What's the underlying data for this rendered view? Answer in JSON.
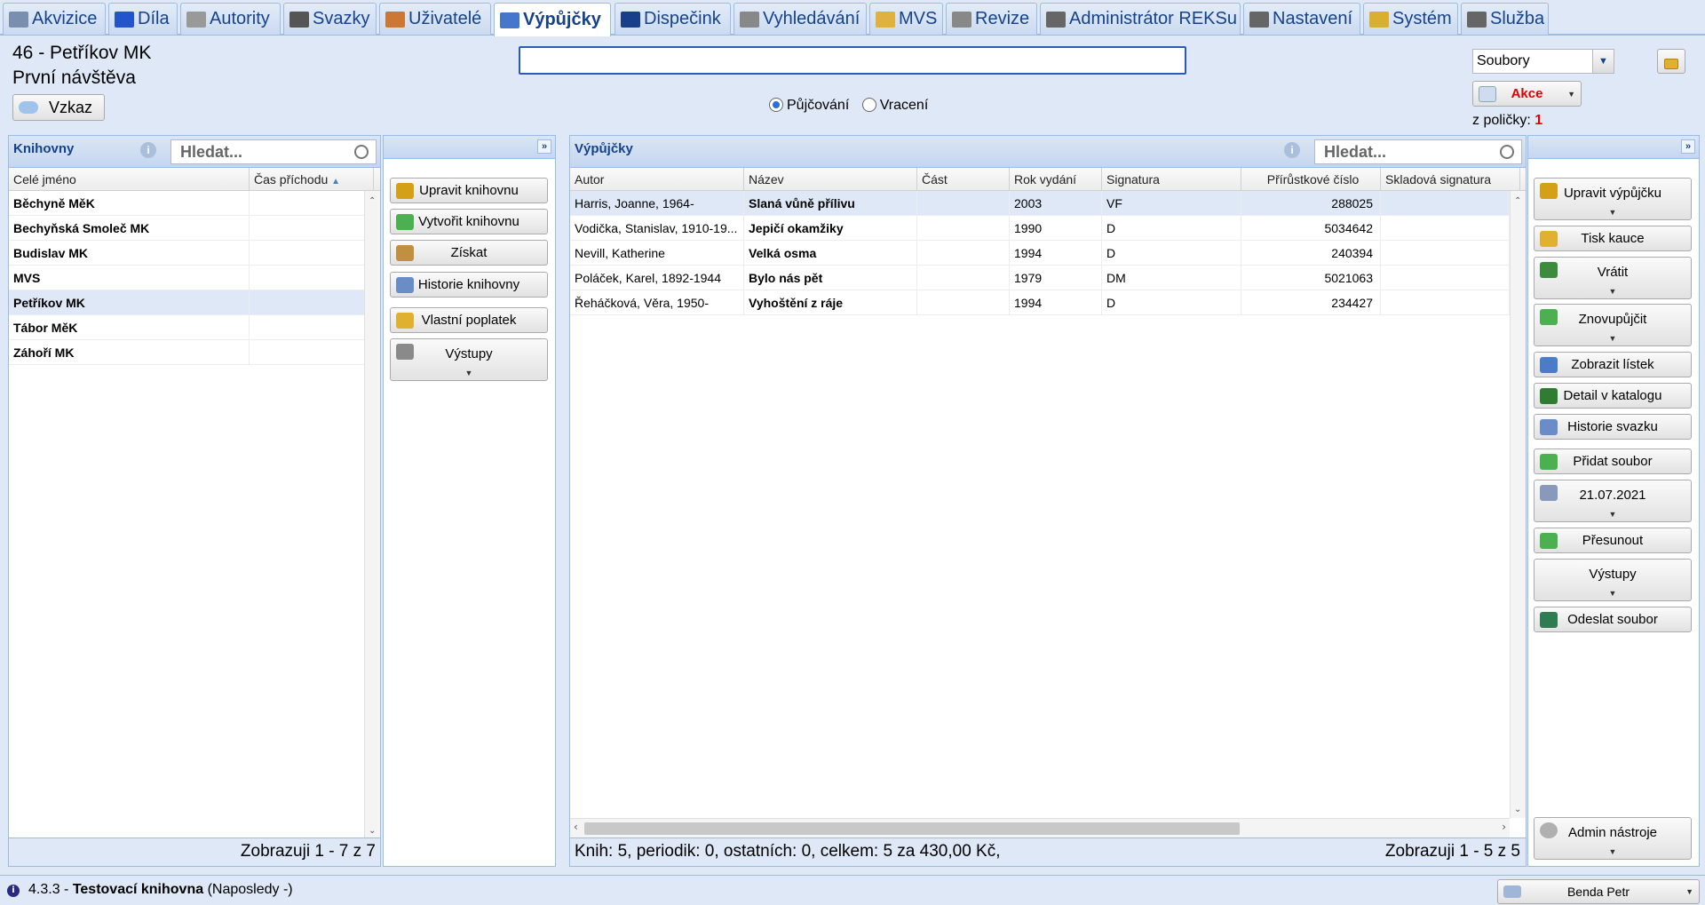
{
  "tabs": [
    {
      "label": "Akvizice",
      "icon": "cart-icon",
      "color": "#7a8fb0"
    },
    {
      "label": "Díla",
      "icon": "book-icon",
      "color": "#2255cc"
    },
    {
      "label": "Autority",
      "icon": "card-icon",
      "color": "#999999"
    },
    {
      "label": "Svazky",
      "icon": "pen-icon",
      "color": "#555555"
    },
    {
      "label": "Uživatelé",
      "icon": "users-icon",
      "color": "#cc7733"
    },
    {
      "label": "Výpůjčky",
      "icon": "books-icon",
      "color": "#4477cc"
    },
    {
      "label": "Dispečink",
      "icon": "monitor-icon",
      "color": "#1a3f8a"
    },
    {
      "label": "Vyhledávání",
      "icon": "cabinet-icon",
      "color": "#888888"
    },
    {
      "label": "MVS",
      "icon": "box-icon",
      "color": "#e0b040"
    },
    {
      "label": "Revize",
      "icon": "list-icon",
      "color": "#888888"
    },
    {
      "label": "Administrátor REKSu",
      "icon": "tools-icon",
      "color": "#666666"
    },
    {
      "label": "Nastavení",
      "icon": "tools-icon",
      "color": "#666666"
    },
    {
      "label": "Systém",
      "icon": "key-icon",
      "color": "#d8b030"
    },
    {
      "label": "Služba",
      "icon": "tools-icon",
      "color": "#666666"
    }
  ],
  "header": {
    "library_name": "46 - Petříkov MK",
    "visit": "První návštěva",
    "message_button": "Vzkaz",
    "barcode_value": "",
    "radio_lend": "Půjčování",
    "radio_return": "Vracení",
    "files_select": "Soubory",
    "actions_button": "Akce",
    "shelf_label": "z poličky:",
    "shelf_count": "1"
  },
  "libraries": {
    "title": "Knihovny",
    "search_placeholder": "Hledat...",
    "columns": [
      "Celé jméno",
      "Čas příchodu"
    ],
    "rows": [
      {
        "name": "Běchyně MěK",
        "time": ""
      },
      {
        "name": "Bechyňská Smoleč MK",
        "time": ""
      },
      {
        "name": "Budislav MK",
        "time": ""
      },
      {
        "name": "MVS",
        "time": ""
      },
      {
        "name": "Petříkov MK",
        "time": ""
      },
      {
        "name": "Tábor MěK",
        "time": ""
      },
      {
        "name": "Záhoří MK",
        "time": ""
      }
    ],
    "footer": "Zobrazuji 1 - 7 z 7"
  },
  "library_actions": [
    {
      "label": "Upravit knihovnu",
      "icon": "pencil-icon",
      "color": "#d4a017"
    },
    {
      "label": "Vytvořit knihovnu",
      "icon": "add-icon",
      "color": "#4caf50"
    },
    {
      "label": "Získat",
      "icon": "coins-icon",
      "color": "#c09040"
    },
    {
      "label": "Historie knihovny",
      "icon": "info-icon",
      "color": "#6a8cc7"
    },
    {
      "label": "Vlastní poplatek",
      "icon": "money-icon",
      "color": "#e0b030"
    },
    {
      "label": "Výstupy",
      "icon": "printer-icon",
      "color": "#8a8a8a"
    }
  ],
  "loans": {
    "title": "Výpůjčky",
    "search_placeholder": "Hledat...",
    "columns": [
      "Autor",
      "Název",
      "Část",
      "Rok vydání",
      "Signatura",
      "Přírůstkové číslo",
      "Skladová signatura"
    ],
    "rows": [
      {
        "author": "Harris, Joanne, 1964-",
        "title": "Slaná vůně přílivu",
        "part": "",
        "year": "2003",
        "sig": "VF",
        "acc": "288025",
        "store": ""
      },
      {
        "author": "Vodička, Stanislav, 1910-19...",
        "title": "Jepičí okamžiky",
        "part": "",
        "year": "1990",
        "sig": "D",
        "acc": "5034642",
        "store": ""
      },
      {
        "author": "Nevill, Katherine",
        "title": "Velká osma",
        "part": "",
        "year": "1994",
        "sig": "D",
        "acc": "240394",
        "store": ""
      },
      {
        "author": "Poláček, Karel, 1892-1944",
        "title": "Bylo nás pět",
        "part": "",
        "year": "1979",
        "sig": "DM",
        "acc": "5021063",
        "store": ""
      },
      {
        "author": "Řeháčková, Věra, 1950-",
        "title": "Vyhoštění z ráje",
        "part": "",
        "year": "1994",
        "sig": "D",
        "acc": "234427",
        "store": ""
      }
    ],
    "summary": "Knih: 5, periodik: 0, ostatních: 0, celkem: 5 za 430,00 Kč,",
    "footer": "Zobrazuji 1 - 5 z 5"
  },
  "loan_actions": [
    {
      "label": "Upravit výpůjčku",
      "icon": "edit-icon",
      "color": "#d4a017"
    },
    {
      "label": "Tisk kauce",
      "icon": "coins-icon",
      "color": "#e0b030"
    },
    {
      "label": "Vrátit",
      "icon": "return-icon",
      "color": "#3d8b3d"
    },
    {
      "label": "Znovupůjčit",
      "icon": "renew-icon",
      "color": "#4caf50"
    },
    {
      "label": "Zobrazit lístek",
      "icon": "ticket-icon",
      "color": "#4a7cc7"
    },
    {
      "label": "Detail v katalogu",
      "icon": "globe-icon",
      "color": "#2e7d32"
    },
    {
      "label": "Historie svazku",
      "icon": "info-icon",
      "color": "#6a8cc7"
    },
    {
      "label": "Přidat soubor",
      "icon": "plus-icon",
      "color": "#4caf50"
    },
    {
      "label": "21.07.2021",
      "icon": "search-icon",
      "color": "#8899bb"
    },
    {
      "label": "Přesunout",
      "icon": "arrow-icon",
      "color": "#4caf50"
    },
    {
      "label": "Výstupy",
      "icon": "",
      "color": ""
    },
    {
      "label": "Odeslat soubor",
      "icon": "send-icon",
      "color": "#2e7d52"
    }
  ],
  "admin_tools": "Admin nástroje",
  "status": {
    "version": "4.3.3 - ",
    "library": "Testovací knihovna",
    "last": " (Naposledy -)",
    "user": "Benda Petr"
  }
}
